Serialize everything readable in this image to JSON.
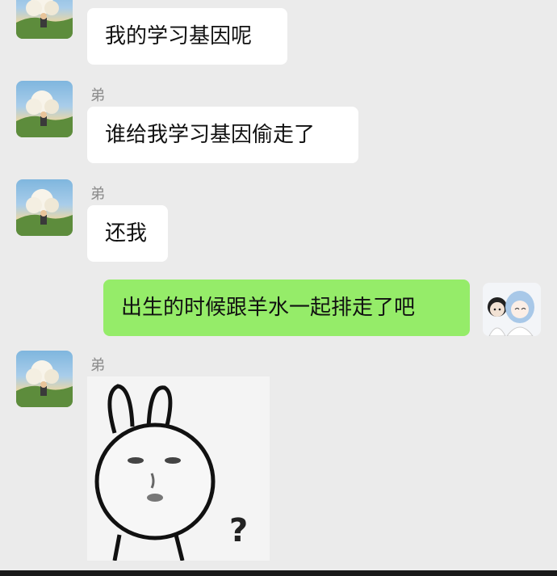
{
  "chat": {
    "messages": [
      {
        "sender": "",
        "text": "我的学习基因呢"
      },
      {
        "sender": "弟",
        "text": "谁给我学习基因偷走了"
      },
      {
        "sender": "弟",
        "text": "还我"
      },
      {
        "sender": "me",
        "text": "出生的时候跟羊水一起排走了吧"
      },
      {
        "sender": "弟",
        "sticker_text": "?"
      }
    ]
  },
  "colors": {
    "background": "#ebebeb",
    "incoming_bubble": "#ffffff",
    "outgoing_bubble": "#95ec69",
    "sender_name": "#8a8a8a"
  },
  "icons": {
    "contact_avatar": "landscape-avatar-icon",
    "own_avatar": "anime-couple-avatar-icon",
    "sticker": "rabbit-face-sticker"
  }
}
